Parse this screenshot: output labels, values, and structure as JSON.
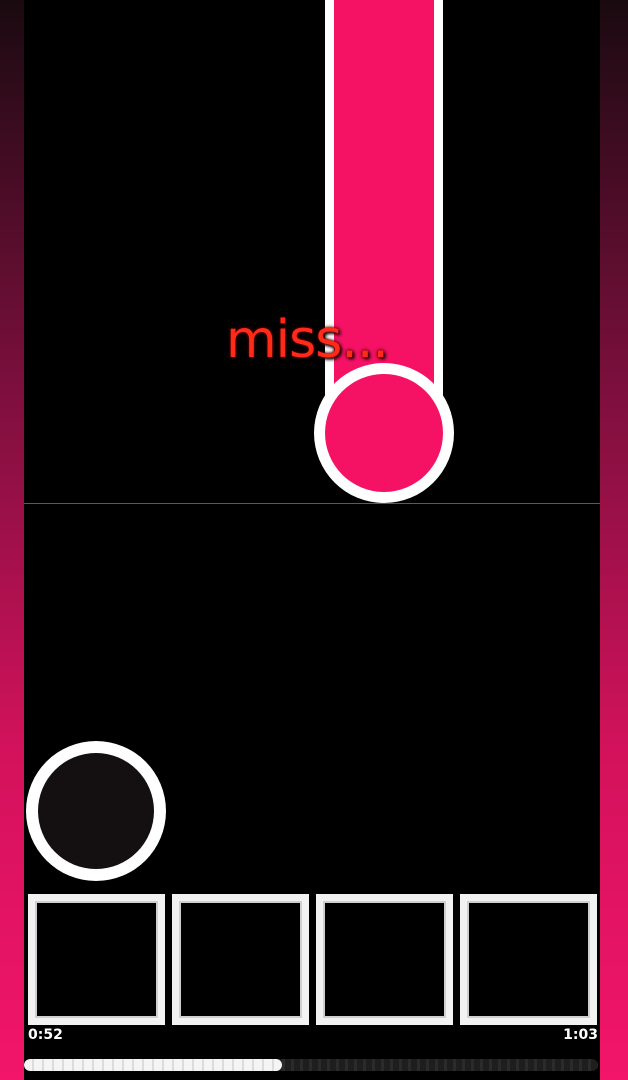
{
  "judgement": {
    "text": "miss..."
  },
  "timeline": {
    "elapsed": "0:52",
    "total": "1:03",
    "progress": 0.45
  },
  "lanes": {
    "count": 4
  },
  "colors": {
    "note_fill": "#f51264",
    "note_border": "#ffffff",
    "judgement_text": "#ff2a18",
    "side_rail_top": "#1a0a10",
    "side_rail_bottom": "#f2156a",
    "background": "#000000",
    "lane_pad_border": "#f2f2f2",
    "touch_circle_fill": "#141011"
  },
  "icons": {
    "hold_note": "hold-note",
    "tap_target": "touch-circle"
  }
}
